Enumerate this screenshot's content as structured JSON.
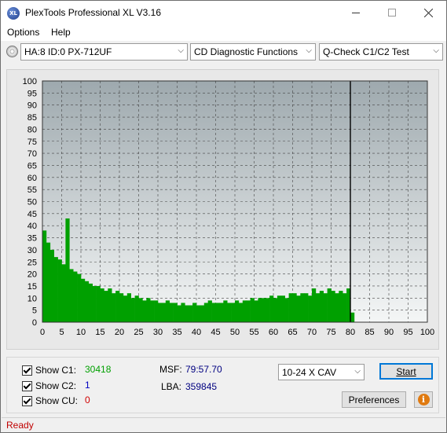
{
  "window": {
    "title": "PlexTools Professional XL V3.16",
    "app_icon_text": "XL"
  },
  "menu": {
    "options": "Options",
    "help": "Help"
  },
  "toolbar": {
    "drive": "HA:8 ID:0  PX-712UF",
    "function": "CD Diagnostic Functions",
    "test": "Q-Check C1/C2 Test"
  },
  "chart_data": {
    "type": "bar",
    "x_ticks": [
      0,
      5,
      10,
      15,
      20,
      25,
      30,
      35,
      40,
      45,
      50,
      55,
      60,
      65,
      70,
      75,
      80,
      85,
      90,
      95,
      100
    ],
    "y_ticks": [
      0,
      5,
      10,
      15,
      20,
      25,
      30,
      35,
      40,
      45,
      50,
      55,
      60,
      65,
      70,
      75,
      80,
      85,
      90,
      95,
      100
    ],
    "xlim": [
      0,
      100
    ],
    "ylim": [
      0,
      100
    ],
    "grid": true,
    "end_marker_x": 80,
    "series": [
      {
        "name": "C1",
        "color": "#00a000",
        "x": [
          0,
          1,
          2,
          3,
          4,
          5,
          6,
          7,
          8,
          9,
          10,
          11,
          12,
          13,
          14,
          15,
          16,
          17,
          18,
          19,
          20,
          21,
          22,
          23,
          24,
          25,
          26,
          27,
          28,
          29,
          30,
          31,
          32,
          33,
          34,
          35,
          36,
          37,
          38,
          39,
          40,
          41,
          42,
          43,
          44,
          45,
          46,
          47,
          48,
          49,
          50,
          51,
          52,
          53,
          54,
          55,
          56,
          57,
          58,
          59,
          60,
          61,
          62,
          63,
          64,
          65,
          66,
          67,
          68,
          69,
          70,
          71,
          72,
          73,
          74,
          75,
          76,
          77,
          78,
          79,
          80
        ],
        "values": [
          38,
          33,
          30,
          27,
          26,
          24,
          43,
          22,
          21,
          20,
          18,
          17,
          16,
          15,
          15,
          14,
          13,
          14,
          12,
          13,
          12,
          11,
          12,
          10,
          11,
          10,
          9,
          10,
          9,
          9,
          8,
          8,
          9,
          8,
          8,
          7,
          8,
          7,
          7,
          8,
          7,
          7,
          8,
          9,
          8,
          8,
          8,
          9,
          8,
          8,
          9,
          8,
          9,
          9,
          10,
          9,
          10,
          10,
          10,
          11,
          10,
          11,
          11,
          10,
          12,
          12,
          11,
          12,
          12,
          11,
          14,
          12,
          13,
          12,
          14,
          13,
          12,
          13,
          12,
          14,
          4
        ]
      }
    ]
  },
  "stats": {
    "show_c1_label": "Show C1:",
    "c1_value": "30418",
    "show_c2_label": "Show C2:",
    "c2_value": "1",
    "show_cu_label": "Show CU:",
    "cu_value": "0",
    "msf_label": "MSF:",
    "msf_value": "79:57.70",
    "lba_label": "LBA:",
    "lba_value": "359845"
  },
  "controls": {
    "speed": "10-24 X CAV",
    "start_label": "Start",
    "preferences_label": "Preferences",
    "info_label": "i"
  },
  "colors": {
    "c1_value": "#00a000",
    "c2_value": "#0000c0",
    "cu_value": "#d00000",
    "msf_value": "#000080",
    "status": "#c00000"
  },
  "status": {
    "text": "Ready"
  }
}
